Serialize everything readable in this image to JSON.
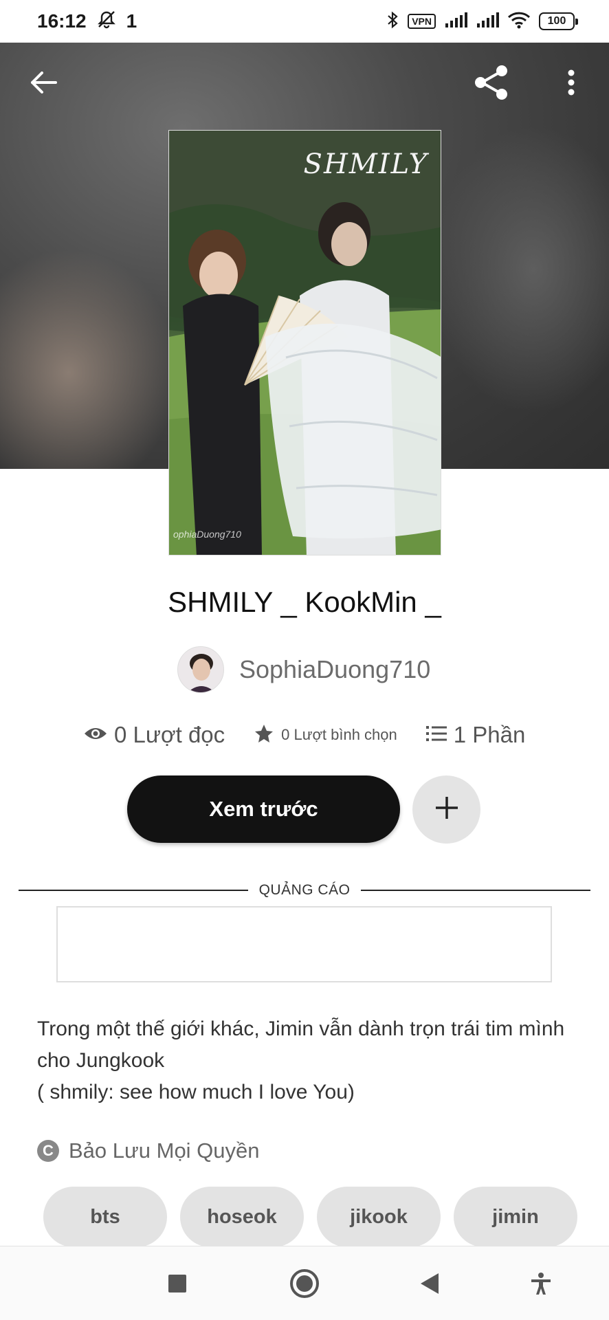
{
  "status_bar": {
    "time": "16:12",
    "signal_label": "1",
    "vpn": "VPN",
    "battery": "100"
  },
  "header": {
    "back_icon": "arrow-left-icon",
    "share_icon": "share-icon",
    "more_icon": "more-vertical-icon"
  },
  "cover": {
    "title_text": "SHMILY",
    "watermark": "ophiaDuong710"
  },
  "story": {
    "title": "SHMILY _ KookMin _",
    "author": "SophiaDuong710",
    "stats": {
      "reads": "0 Lượt đọc",
      "votes": "0 Lượt bình chọn",
      "parts": "1 Phần"
    },
    "preview_button": "Xem trước",
    "add_button_icon": "plus-icon",
    "ad_label": "QUẢNG CÁO",
    "description": "Trong một thế giới khác, Jimin vẫn dành trọn trái tim mình cho Jungkook\n( shmily: see how much I love You)",
    "copyright": "Bảo Lưu Mọi Quyền",
    "tags": [
      "bts",
      "hoseok",
      "jikook",
      "jimin"
    ]
  },
  "nav": {
    "recents_icon": "square-icon",
    "home_icon": "circle-home-icon",
    "back_icon": "triangle-back-icon",
    "accessibility_icon": "accessibility-icon"
  },
  "colors": {
    "button_dark": "#121212",
    "tag_bg": "#e3e3e3",
    "text_muted": "#6b6b6b"
  }
}
